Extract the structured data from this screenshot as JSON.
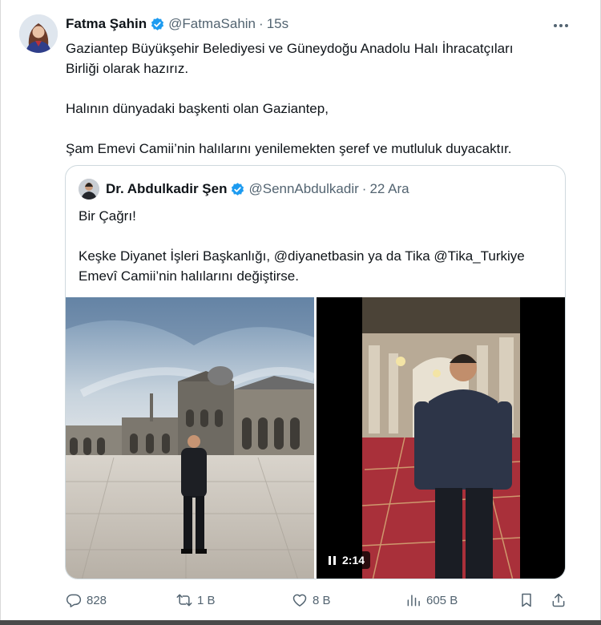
{
  "tweet": {
    "author_name": "Fatma Şahin",
    "author_handle": "@FatmaSahin",
    "separator": "·",
    "time": "15s",
    "lines": [
      "Gaziantep Büyükşehir Belediyesi ve Güneydoğu Anadolu Halı İhracatçıları",
      "Birliği olarak hazırız.",
      "Halının dünyadaki başkenti olan Gaziantep,",
      "Şam Emevi Camii’nin halılarını yenilemekten şeref ve mutluluk duyacaktır."
    ]
  },
  "quote": {
    "author_name": "Dr. Abdulkadir Şen",
    "author_handle": "@SennAbdulkadir",
    "separator": "·",
    "time": "22 Ara",
    "lines": [
      "Bir Çağrı!",
      "Keşke Diyanet İşleri Başkanlığı, @diyanetbasin ya da Tika @Tika_Turkiye",
      "Emevî Camii’nin halılarını değiştirse."
    ],
    "video_duration": "2:14"
  },
  "actions": {
    "replies": "828",
    "retweets": "1 B",
    "likes": "8 B",
    "views": "605 B"
  },
  "colors": {
    "text": "#0f1419",
    "secondary": "#536471",
    "verified": "#1d9bf0",
    "border": "#cfd9de"
  },
  "icons": [
    "verified-badge-icon",
    "more-icon",
    "reply-icon",
    "retweet-icon",
    "like-icon",
    "views-icon",
    "bookmark-icon",
    "share-icon",
    "pause-icon"
  ]
}
